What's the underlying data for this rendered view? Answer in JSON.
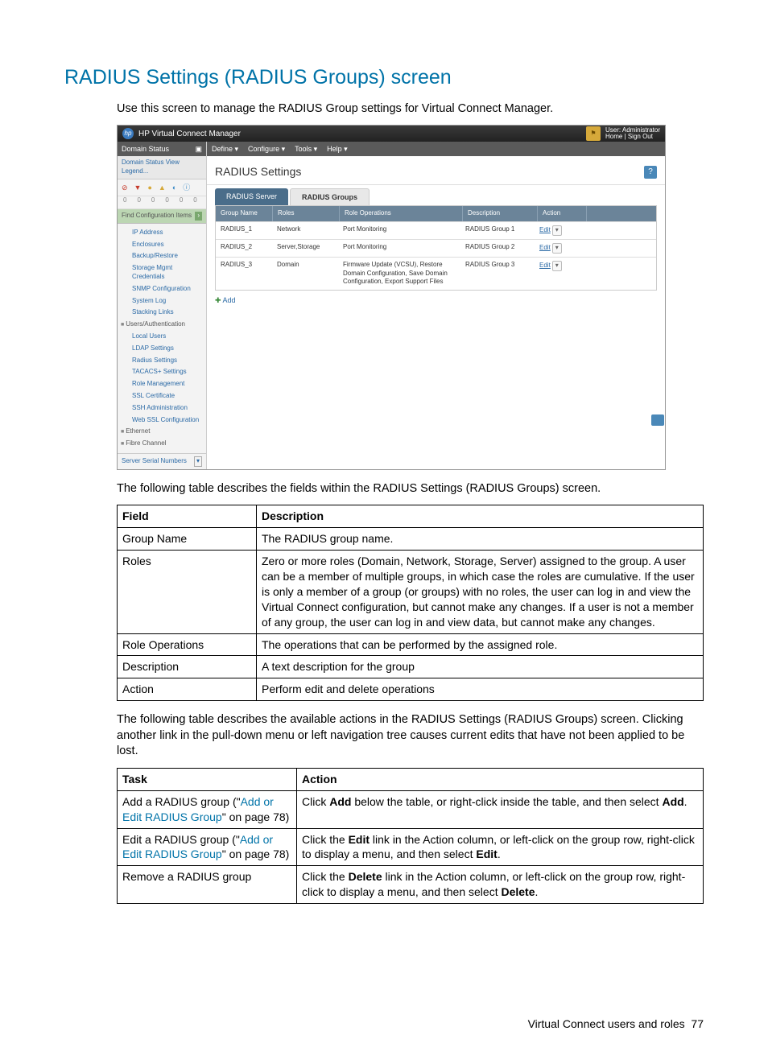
{
  "heading": "RADIUS Settings (RADIUS Groups) screen",
  "intro": "Use this screen to manage the RADIUS Group settings for Virtual Connect Manager.",
  "screenshot": {
    "app_title": "HP Virtual Connect Manager",
    "user_label": "User: Administrator",
    "user_links": "Home | Sign Out",
    "sidebar": {
      "domain_status": "Domain Status",
      "domain_sub": "Domain Status     View Legend...",
      "find": "Find Configuration Items",
      "items_top": [
        "IP Address",
        "Enclosures",
        "Backup/Restore",
        "Storage Mgmt Credentials",
        "SNMP Configuration",
        "System Log",
        "Stacking Links"
      ],
      "cat_users": "Users/Authentication",
      "items_users": [
        "Local Users",
        "LDAP Settings",
        "Radius Settings",
        "TACACS+ Settings",
        "Role Management",
        "SSL Certificate",
        "SSH Administration",
        "Web SSL Configuration"
      ],
      "cat_eth": "Ethernet",
      "cat_fc": "Fibre Channel",
      "foot": "Server Serial Numbers"
    },
    "menus": [
      "Define ▾",
      "Configure ▾",
      "Tools ▾",
      "Help ▾"
    ],
    "panel_title": "RADIUS Settings",
    "tabs": {
      "server": "RADIUS Server",
      "groups": "RADIUS Groups"
    },
    "columns": [
      "Group Name",
      "Roles",
      "Role Operations",
      "Description",
      "Action"
    ],
    "rows": [
      {
        "name": "RADIUS_1",
        "roles": "Network",
        "ops": "Port Monitoring",
        "desc": "RADIUS Group 1",
        "action": "Edit"
      },
      {
        "name": "RADIUS_2",
        "roles": "Server,Storage",
        "ops": "Port Monitoring",
        "desc": "RADIUS Group 2",
        "action": "Edit"
      },
      {
        "name": "RADIUS_3",
        "roles": "Domain",
        "ops": "Firmware Update (VCSU), Restore Domain Configuration, Save Domain Configuration, Export Support Files",
        "desc": "RADIUS Group 3",
        "action": "Edit"
      }
    ],
    "add": "Add"
  },
  "para_after_shot": "The following table describes the fields within the RADIUS Settings (RADIUS Groups) screen.",
  "fields_table": {
    "h1": "Field",
    "h2": "Description",
    "rows": [
      {
        "f": "Group Name",
        "d": "The RADIUS group name."
      },
      {
        "f": "Roles",
        "d": "Zero or more roles (Domain, Network, Storage, Server) assigned to the group. A user can be a member of multiple groups, in which case the roles are cumulative. If the user is only a member of a group (or groups) with no roles, the user can log in and view the Virtual Connect configuration, but cannot make any changes. If a user is not a member of any group, the user can log in and view data, but cannot make any changes."
      },
      {
        "f": "Role Operations",
        "d": "The operations that can be performed by the assigned role."
      },
      {
        "f": "Description",
        "d": "A text description for the group"
      },
      {
        "f": "Action",
        "d": "Perform edit and delete operations"
      }
    ]
  },
  "para_after_fields": "The following table describes the available actions in the RADIUS Settings (RADIUS Groups) screen. Clicking another link in the pull-down menu or left navigation tree causes current edits that have not been applied to be lost.",
  "tasks_table": {
    "h1": "Task",
    "h2": "Action",
    "rows": [
      {
        "t_pre": "Add a RADIUS group (\"",
        "t_link": "Add or Edit RADIUS Group",
        "t_post": "\" on page 78)",
        "a_pre": "Click ",
        "a_b1": "Add",
        "a_mid": " below the table, or right-click inside the table, and then select ",
        "a_b2": "Add",
        "a_post": "."
      },
      {
        "t_pre": "Edit a RADIUS group (\"",
        "t_link": "Add or Edit RADIUS Group",
        "t_post": "\" on page 78)",
        "a_pre": "Click the ",
        "a_b1": "Edit",
        "a_mid": " link in the Action column, or left-click on the group row, right-click to display a menu, and then select ",
        "a_b2": "Edit",
        "a_post": "."
      },
      {
        "t_pre": "Remove a RADIUS group",
        "t_link": "",
        "t_post": "",
        "a_pre": "Click the ",
        "a_b1": "Delete",
        "a_mid": " link in the Action column, or left-click on the group row, right-click to display a menu, and then select ",
        "a_b2": "Delete",
        "a_post": "."
      }
    ]
  },
  "footer": {
    "text": "Virtual Connect users and roles",
    "page": "77"
  }
}
